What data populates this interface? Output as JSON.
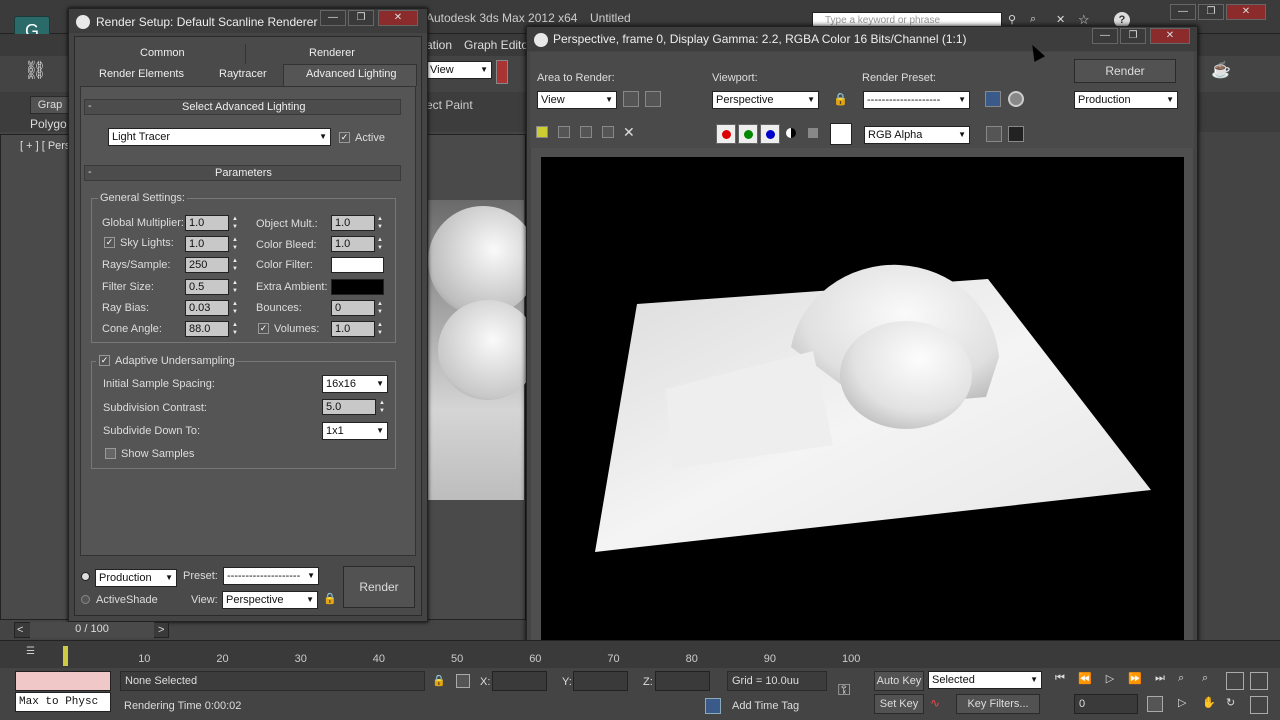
{
  "app": {
    "title": "Autodesk 3ds Max  2012 x64",
    "doc": "Untitled",
    "search_placeholder": "Type a keyword or phrase",
    "menu": {
      "item1": "ation",
      "item2": "Graph Editor"
    },
    "viewport_label": "[ + ] [ Pers",
    "ribbon_tabs": [
      "Grap",
      "Polygo"
    ],
    "view_dropdown": "View",
    "object_paint": "ect Paint"
  },
  "render_setup": {
    "title": "Render Setup: Default Scanline Renderer",
    "tabs_row1": [
      "Common",
      "Renderer"
    ],
    "tabs_row2": [
      "Render Elements",
      "Raytracer",
      "Advanced Lighting"
    ],
    "rollout_select": "Select Advanced Lighting",
    "lighting_type": "Light Tracer",
    "active_label": "Active",
    "rollout_params": "Parameters",
    "general_settings": "General Settings:",
    "global_multiplier_label": "Global Multiplier:",
    "global_multiplier": "1.0",
    "object_mult_label": "Object Mult.:",
    "object_mult": "1.0",
    "sky_lights_label": "Sky Lights:",
    "sky_lights": "1.0",
    "color_bleed_label": "Color Bleed:",
    "color_bleed": "1.0",
    "rays_label": "Rays/Sample:",
    "rays": "250",
    "color_filter_label": "Color Filter:",
    "filter_size_label": "Filter Size:",
    "filter_size": "0.5",
    "extra_ambient_label": "Extra Ambient:",
    "ray_bias_label": "Ray Bias:",
    "ray_bias": "0.03",
    "bounces_label": "Bounces:",
    "bounces": "0",
    "cone_angle_label": "Cone Angle:",
    "cone_angle": "88.0",
    "volumes_label": "Volumes:",
    "volumes": "1.0",
    "adaptive_label": "Adaptive Undersampling",
    "initial_spacing_label": "Initial Sample Spacing:",
    "initial_spacing": "16x16",
    "subdiv_contrast_label": "Subdivision Contrast:",
    "subdiv_contrast": "5.0",
    "subdivide_down_label": "Subdivide Down To:",
    "subdivide_down": "1x1",
    "show_samples_label": "Show Samples",
    "mode_production": "Production",
    "mode_activeshade": "ActiveShade",
    "preset_label": "Preset:",
    "preset_value": "--------------------",
    "view_label": "View:",
    "view_value": "Perspective",
    "render_button": "Render"
  },
  "frame_window": {
    "title": "Perspective, frame 0, Display Gamma: 2.2, RGBA Color 16 Bits/Channel (1:1)",
    "area_to_render_label": "Area to Render:",
    "area_to_render": "View",
    "viewport_label": "Viewport:",
    "viewport": "Perspective",
    "render_preset_label": "Render Preset:",
    "render_preset": "--------------------",
    "render_button": "Render",
    "production": "Production",
    "channel": "RGB Alpha"
  },
  "timeline": {
    "counter": "0 / 100",
    "ticks": [
      "10",
      "20",
      "30",
      "40",
      "50",
      "60",
      "70",
      "80",
      "90",
      "100"
    ]
  },
  "status": {
    "maxscript": "Max to Physc",
    "none_selected": "None Selected",
    "rendering_time": "Rendering Time  0:00:02",
    "x_label": "X:",
    "y_label": "Y:",
    "z_label": "Z:",
    "grid": "Grid = 10.0uu",
    "add_time_tag": "Add Time Tag",
    "auto_key": "Auto Key",
    "set_key": "Set Key",
    "selected": "Selected",
    "key_filters": "Key Filters...",
    "frame": "0"
  }
}
